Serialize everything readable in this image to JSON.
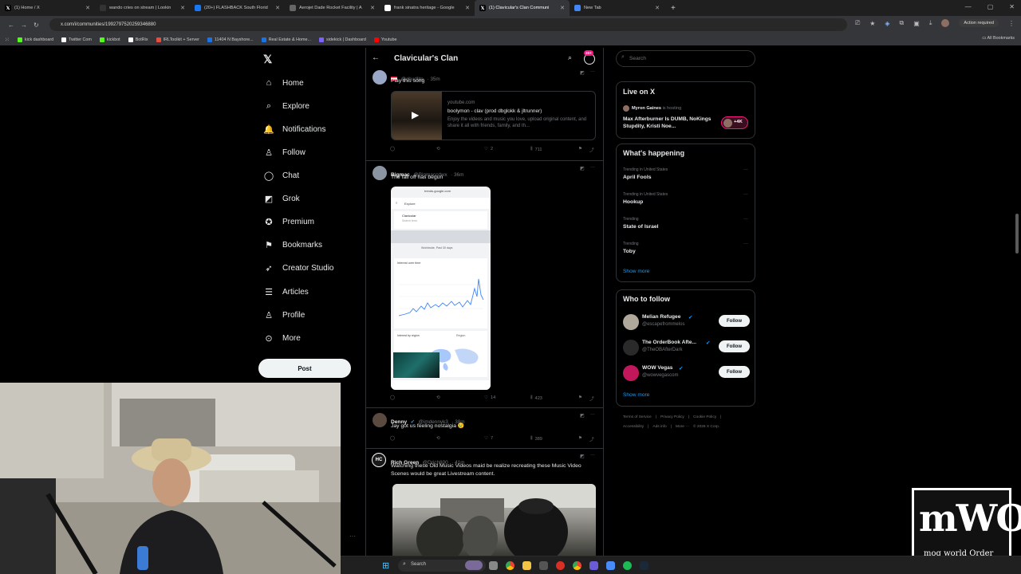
{
  "browser": {
    "tabs": [
      {
        "title": "(1) Home / X",
        "icon": "x-icon",
        "active": false
      },
      {
        "title": "wando cries on stream | Lookin",
        "icon": "lookin-icon",
        "active": false
      },
      {
        "title": "(20+) FLASHBACK South Florid",
        "icon": "facebook-icon",
        "active": false
      },
      {
        "title": "Aerojet Dade Rocket Facility | A",
        "icon": "globe-icon",
        "active": false
      },
      {
        "title": "frank sinatra heritage - Google",
        "icon": "google-icon",
        "active": false
      },
      {
        "title": "(1) Clavicular's Clan Communi",
        "icon": "x-icon",
        "active": true
      },
      {
        "title": "New Tab",
        "icon": "chrome-icon",
        "active": false
      }
    ],
    "url": "x.com/i/communities/1992797520259346880",
    "action_required": "Action required",
    "all_bookmarks": "All Bookmarks",
    "bookmarks": [
      {
        "label": "kick dashboard",
        "color": "#53fc18"
      },
      {
        "label": "Twitter Com",
        "color": "#ffffff"
      },
      {
        "label": "kickbot",
        "color": "#53fc18"
      },
      {
        "label": "BotRix",
        "color": "#ffffff"
      },
      {
        "label": "IRLToolkit + Server",
        "color": "#e74c3c"
      },
      {
        "label": "11404 N Bayshore...",
        "color": "#1a73e8"
      },
      {
        "label": "Real Estate & Home...",
        "color": "#1a73e8"
      },
      {
        "label": "sidekick | Dashboard",
        "color": "#7b61ff"
      },
      {
        "label": "Youtube",
        "color": "#ff0000"
      }
    ]
  },
  "nav": {
    "items": [
      {
        "label": "Home",
        "icon": "home-icon",
        "glyph": "⌂"
      },
      {
        "label": "Explore",
        "icon": "search-icon",
        "glyph": "⌕"
      },
      {
        "label": "Notifications",
        "icon": "bell-icon",
        "glyph": "🔔"
      },
      {
        "label": "Follow",
        "icon": "person-plus-icon",
        "glyph": "♙"
      },
      {
        "label": "Chat",
        "icon": "chat-icon",
        "glyph": "◯"
      },
      {
        "label": "Grok",
        "icon": "grok-icon",
        "glyph": "◩"
      },
      {
        "label": "Premium",
        "icon": "premium-icon",
        "glyph": "✪"
      },
      {
        "label": "Bookmarks",
        "icon": "bookmark-icon",
        "glyph": "⚑"
      },
      {
        "label": "Creator Studio",
        "icon": "rocket-icon",
        "glyph": "➶"
      },
      {
        "label": "Articles",
        "icon": "article-icon",
        "glyph": "☰"
      },
      {
        "label": "Profile",
        "icon": "profile-icon",
        "glyph": "♙"
      },
      {
        "label": "More",
        "icon": "more-icon",
        "glyph": "⊙"
      }
    ],
    "post_label": "Post"
  },
  "feed": {
    "title": "Clavicular's Clan",
    "notif_badge": "20+",
    "tweets": [
      {
        "handle": "@chudlite",
        "time": "35m",
        "text": "Play this song",
        "card": {
          "domain": "youtube.com",
          "title": "boolymon - clav (prod dbglokk & jltrunner)",
          "desc": "Enjoy the videos and music you love, upload original content, and share it all with friends, family, and th..."
        },
        "stats": {
          "reply": "",
          "retweet": "",
          "like": "2",
          "views": "711"
        }
      },
      {
        "name": "Bigmac",
        "handle": "@Bigmaccdwx",
        "time": "36m",
        "text": "The fall off has begun",
        "screenshot": {
          "url_bar": "trends.google.com",
          "explore": "Explore",
          "term": "Clavicular",
          "term_sub": "Search term",
          "filter": "Worldwide, Past 30 days",
          "interest": "Interest over time",
          "region_title": "Interest by region",
          "region_filter": "Region"
        },
        "stats": {
          "reply": "",
          "retweet": "",
          "like": "14",
          "views": "423"
        }
      },
      {
        "name": "Denny",
        "handle": "@imdennyk3",
        "time": "38m",
        "text": "Jay got us feeling nostalgia 😢",
        "stats": {
          "reply": "",
          "retweet": "",
          "like": "7",
          "views": "389"
        }
      },
      {
        "name": "Rich Green",
        "handle": "@Drich800",
        "time": "41m",
        "text": "Watching these Old Music Videos maid be realize recreating these Music Video Scenes would be great Livestream content."
      }
    ]
  },
  "sidebar": {
    "search_placeholder": "Search",
    "live": {
      "title": "Live on X",
      "host": "Myron Gaines",
      "host_suffix": "is hosting",
      "text": "Max Afterburner Is DUMB, NoKings Stupdity, Kristi Noe...",
      "count": "+4K"
    },
    "happening": {
      "title": "What's happening",
      "trends": [
        {
          "meta": "Trending in United States",
          "name": "April Fools"
        },
        {
          "meta": "Trending in United States",
          "name": "Hookup"
        },
        {
          "meta": "Trending",
          "name": "State of Israel"
        },
        {
          "meta": "Trending",
          "name": "Toby"
        }
      ],
      "show_more": "Show more"
    },
    "who_to_follow": {
      "title": "Who to follow",
      "users": [
        {
          "name": "Melian Refugee",
          "handle": "@escapefrommelos",
          "button": "Follow"
        },
        {
          "name": "The OrderBook Afte...",
          "handle": "@TheOBAfterDark",
          "button": "Follow"
        },
        {
          "name": "WOW Vegas",
          "handle": "@wowvegascom",
          "button": "Follow"
        }
      ],
      "show_more": "Show more"
    },
    "footer": {
      "line1": [
        "Terms of Service",
        "|",
        "Privacy Policy",
        "|",
        "Cookie Policy",
        "|"
      ],
      "line2": [
        "Accessibility",
        "|",
        "Ads info",
        "|",
        "More ···",
        "© 2026 X Corp."
      ]
    }
  },
  "overlay": {
    "watermark_line1": "mWO",
    "watermark_line2": "mog world Order"
  },
  "taskbar": {
    "search": "Search"
  },
  "colors": {
    "accent": "#1d9bf0",
    "bg": "#000000",
    "border": "#2f3336",
    "muted": "#71767b",
    "badge": "#f91880"
  }
}
